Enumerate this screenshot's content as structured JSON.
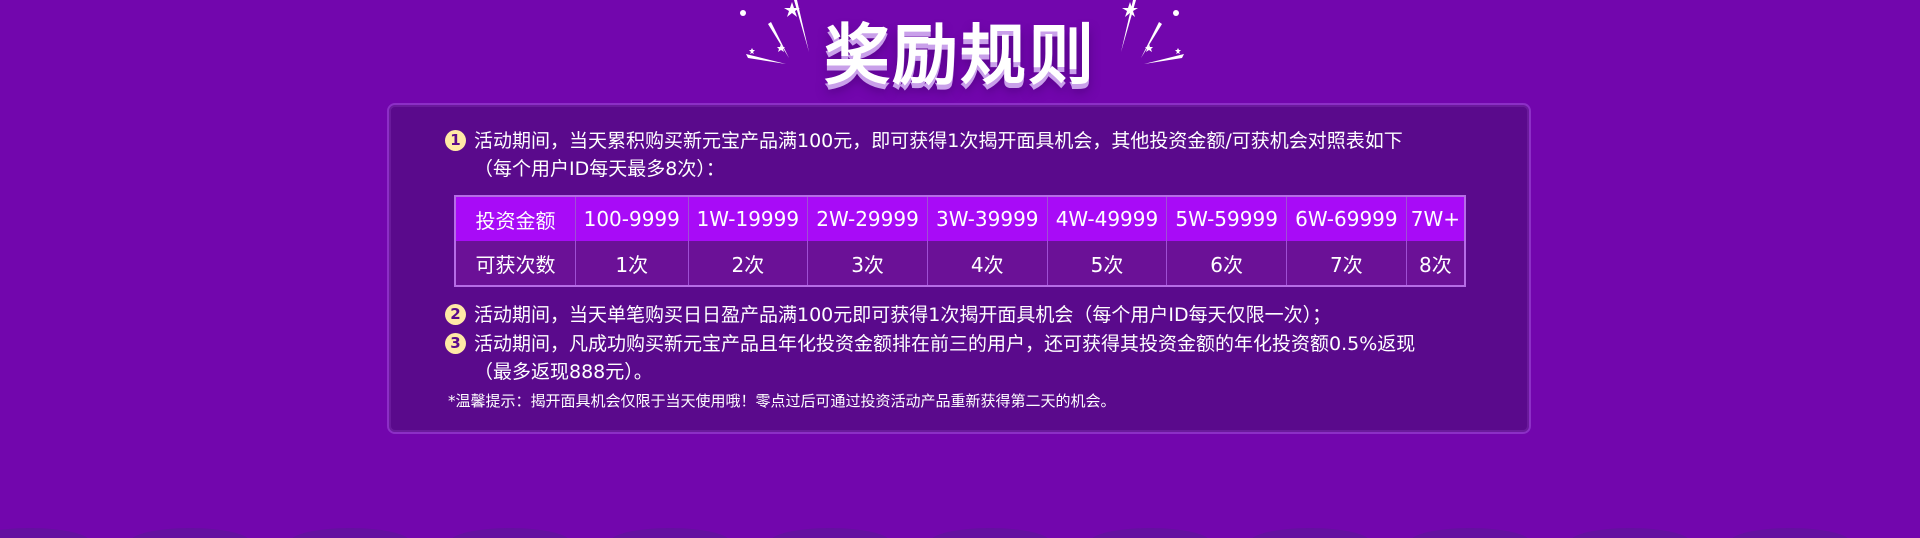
{
  "title": "奖励规则",
  "rules": [
    {
      "num": "1",
      "lines": [
        "活动期间，当天累积购买新元宝产品满100元，即可获得1次揭开面具机会，其他投资金额/可获机会对照表如下",
        "（每个用户ID每天最多8次）："
      ]
    },
    {
      "num": "2",
      "lines": [
        "活动期间，当天单笔购买日日盈产品满100元即可获得1次揭开面具机会（每个用户ID每天仅限一次）；"
      ]
    },
    {
      "num": "3",
      "lines": [
        "活动期间，凡成功购买新元宝产品且年化投资金额排在前三的用户，还可获得其投资金额的年化投资额0.5%返现",
        "（最多返现888元）。"
      ]
    }
  ],
  "table": {
    "row_headers": [
      "投资金额",
      "可获次数"
    ],
    "amounts": [
      "100-9999",
      "1W-19999",
      "2W-29999",
      "3W-39999",
      "4W-49999",
      "5W-59999",
      "6W-69999",
      "7W+"
    ],
    "counts": [
      "1次",
      "2次",
      "3次",
      "4次",
      "5次",
      "6次",
      "7次",
      "8次"
    ]
  },
  "tip": "*温馨提示：揭开面具机会仅限于当天使用哦！零点过后可通过投资活动产品重新获得第二天的机会。",
  "colors": {
    "background": "#7206ad",
    "panel": "#5a0a8c",
    "table_header": "#a80bf7",
    "table_row": "#6b1197",
    "number_badge": "#ffe9a6"
  }
}
